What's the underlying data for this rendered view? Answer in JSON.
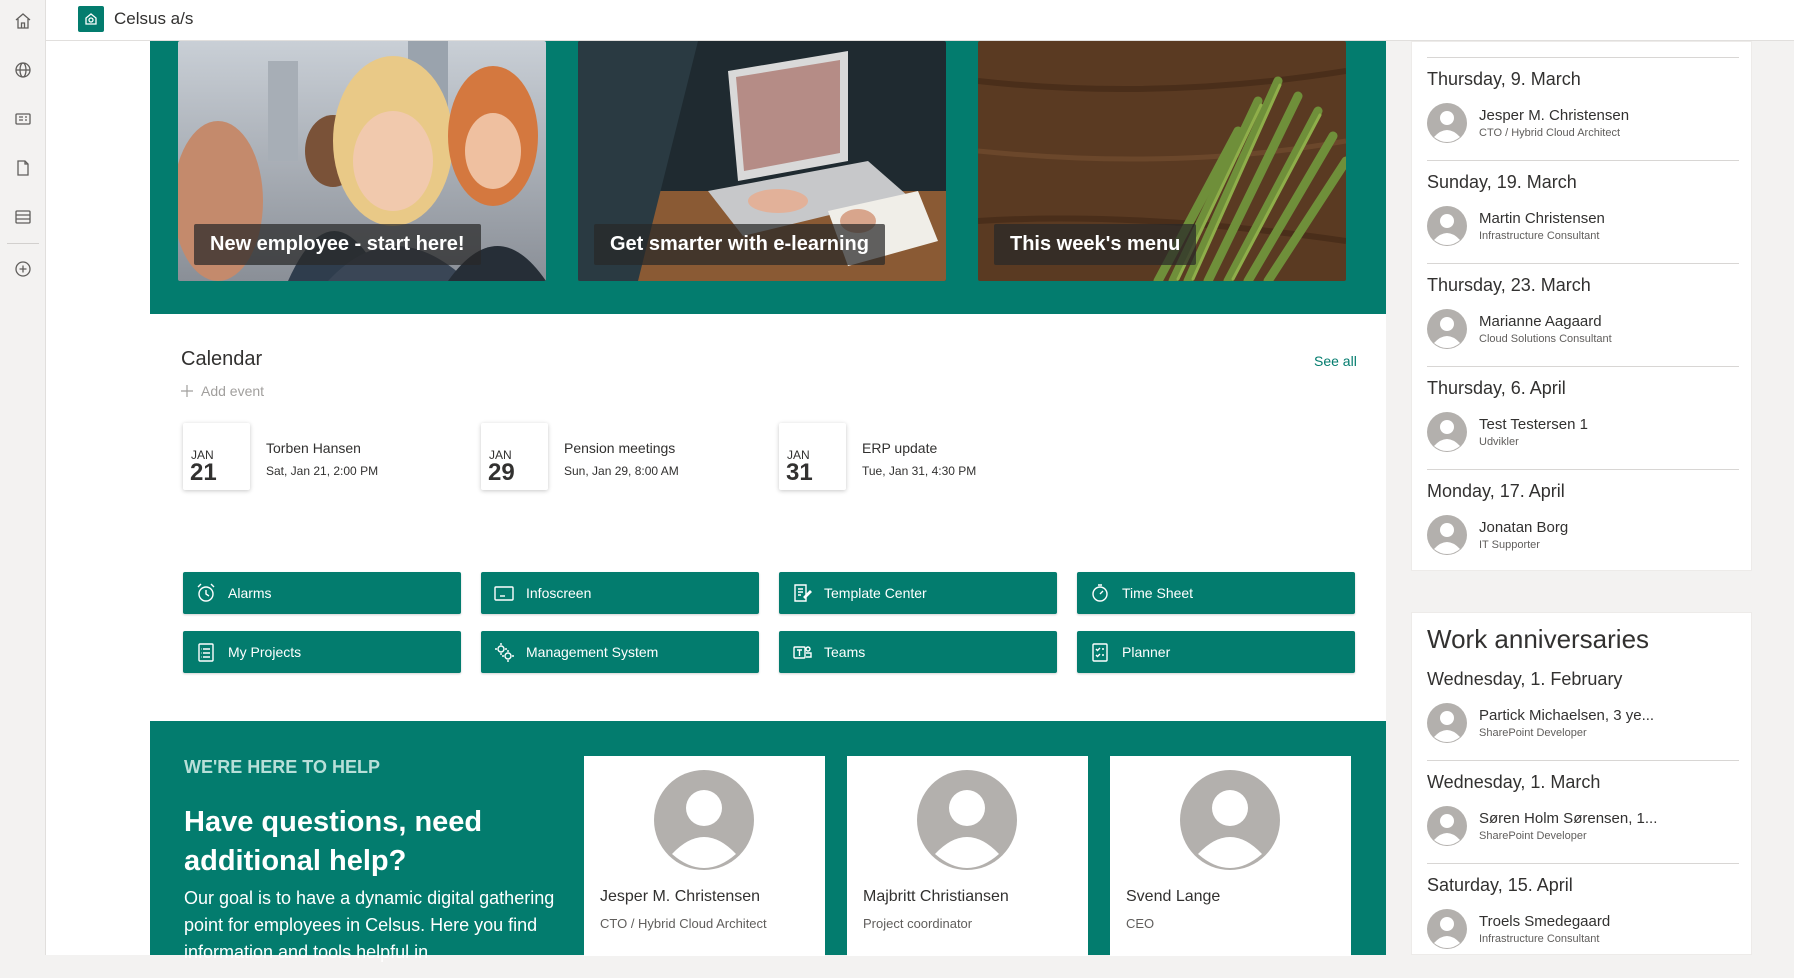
{
  "colors": {
    "accent": "#037c6e",
    "accent_light": "#b8dfd8",
    "avatar_gray": "#b3b0ad"
  },
  "rail": {
    "icons": [
      "home-icon",
      "globe-icon",
      "news-icon",
      "document-icon",
      "list-icon",
      "add-circle-icon"
    ]
  },
  "header": {
    "site_name": "Celsus a/s"
  },
  "hero": {
    "tiles": [
      {
        "label": "New employee - start here!"
      },
      {
        "label": "Get smarter with e-learning"
      },
      {
        "label": "This week's menu"
      }
    ]
  },
  "calendar": {
    "title": "Calendar",
    "see_all": "See all",
    "add_event": "Add event",
    "events": [
      {
        "month": "JAN",
        "day": "21",
        "title": "Torben Hansen",
        "time": "Sat, Jan 21, 2:00 PM"
      },
      {
        "month": "JAN",
        "day": "29",
        "title": "Pension meetings",
        "time": "Sun, Jan 29, 8:00 AM"
      },
      {
        "month": "JAN",
        "day": "31",
        "title": "ERP update",
        "time": "Tue, Jan 31, 4:30 PM"
      }
    ]
  },
  "quicklinks": [
    {
      "label": "Alarms",
      "icon": "alarm-clock-icon"
    },
    {
      "label": "Infoscreen",
      "icon": "screen-icon"
    },
    {
      "label": "Template Center",
      "icon": "template-icon"
    },
    {
      "label": "Time Sheet",
      "icon": "timer-icon"
    },
    {
      "label": "My Projects",
      "icon": "clipboard-list-icon"
    },
    {
      "label": "Management System",
      "icon": "gears-icon"
    },
    {
      "label": "Teams",
      "icon": "teams-icon"
    },
    {
      "label": "Planner",
      "icon": "planner-icon"
    }
  ],
  "help": {
    "kicker": "WE'RE HERE TO HELP",
    "question": "Have questions, need additional help?",
    "body": "Our goal is to have a dynamic digital gathering point for employees in Celsus. Here you find information and tools helpful in",
    "contacts": [
      {
        "name": "Jesper M. Christensen",
        "role": "CTO / Hybrid Cloud Architect"
      },
      {
        "name": "Majbritt Christiansen",
        "role": "Project coordinator"
      },
      {
        "name": "Svend Lange",
        "role": "CEO"
      }
    ]
  },
  "birthdays": [
    {
      "date": "Thursday, 9. March",
      "name": "Jesper M. Christensen",
      "title": "CTO / Hybrid Cloud Architect"
    },
    {
      "date": "Sunday, 19. March",
      "name": "Martin Christensen",
      "title": "Infrastructure Consultant"
    },
    {
      "date": "Thursday, 23. March",
      "name": "Marianne Aagaard",
      "title": "Cloud Solutions Consultant"
    },
    {
      "date": "Thursday, 6. April",
      "name": "Test Testersen 1",
      "title": "Udvikler"
    },
    {
      "date": "Monday, 17. April",
      "name": "Jonatan Borg",
      "title": "IT Supporter"
    }
  ],
  "anniversaries": {
    "title": "Work anniversaries",
    "items": [
      {
        "date": "Wednesday, 1. February",
        "name": "Partick Michaelsen, 3 ye...",
        "title": "SharePoint Developer"
      },
      {
        "date": "Wednesday, 1. March",
        "name": "Søren Holm Sørensen, 1...",
        "title": "SharePoint Developer"
      },
      {
        "date": "Saturday, 15. April",
        "name": "Troels Smedegaard",
        "title": "Infrastructure Consultant"
      }
    ]
  }
}
